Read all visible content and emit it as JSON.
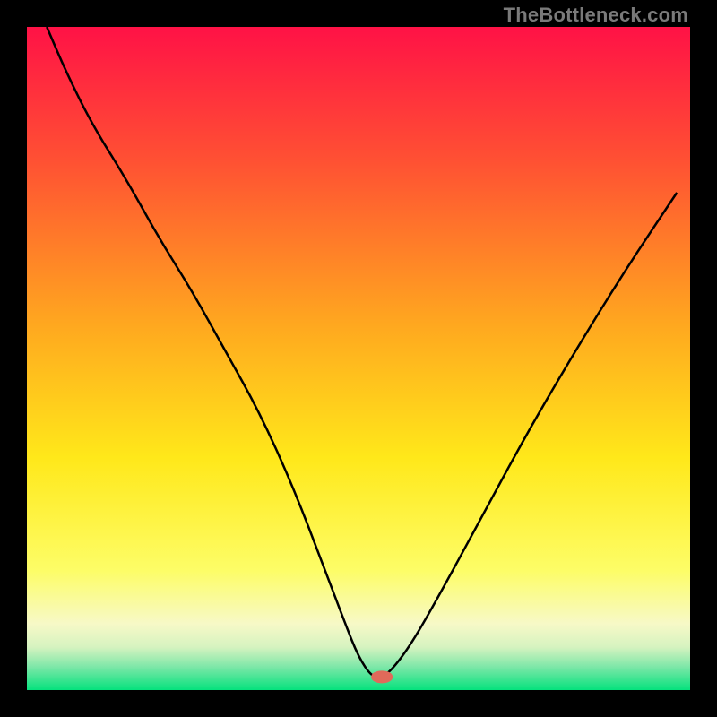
{
  "watermark": "TheBottleneck.com",
  "chart_data": {
    "type": "line",
    "title": "",
    "xlabel": "",
    "ylabel": "",
    "xlim": [
      0,
      100
    ],
    "ylim": [
      0,
      100
    ],
    "grid": false,
    "legend": false,
    "background_gradient": [
      {
        "stop": 0.0,
        "color": "#ff1246"
      },
      {
        "stop": 0.2,
        "color": "#ff5033"
      },
      {
        "stop": 0.45,
        "color": "#ffa81f"
      },
      {
        "stop": 0.65,
        "color": "#ffe81a"
      },
      {
        "stop": 0.82,
        "color": "#fdfd67"
      },
      {
        "stop": 0.9,
        "color": "#f7f9c7"
      },
      {
        "stop": 0.935,
        "color": "#d6f3c0"
      },
      {
        "stop": 0.965,
        "color": "#7de7a8"
      },
      {
        "stop": 1.0,
        "color": "#05e27d"
      }
    ],
    "series": [
      {
        "name": "bottleneck-curve",
        "color": "#000000",
        "stroke_width": 2.5,
        "x": [
          3,
          6,
          10,
          15,
          20,
          25,
          30,
          35,
          40,
          45,
          48,
          50,
          52,
          53.5,
          55,
          58,
          62,
          68,
          75,
          82,
          90,
          98
        ],
        "y": [
          100,
          93,
          85,
          77,
          68,
          60,
          51,
          42,
          31,
          18,
          10,
          5,
          2,
          2,
          3,
          7,
          14,
          25,
          38,
          50,
          63,
          75
        ]
      }
    ],
    "marker": {
      "name": "optimal-point",
      "x": 53.5,
      "y": 2,
      "rx": 1.6,
      "ry": 0.9,
      "color": "#e06a5a"
    }
  }
}
